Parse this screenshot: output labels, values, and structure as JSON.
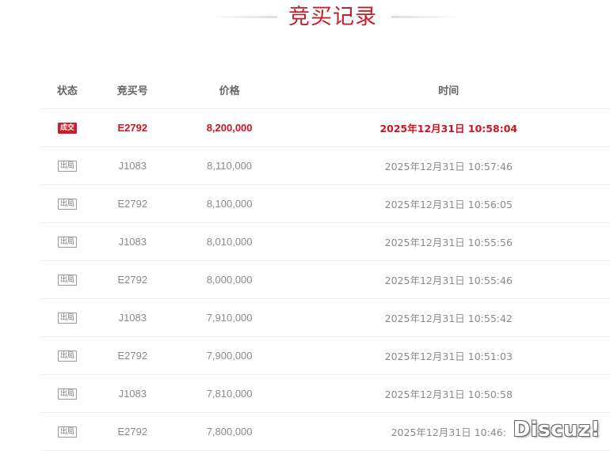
{
  "page_title": "竞买记录",
  "table": {
    "headers": {
      "status": "状态",
      "bid_number": "竞买号",
      "price": "价格",
      "time": "时间"
    },
    "rows": [
      {
        "status": "成交",
        "bid_number": "E2792",
        "price": "8,200,000",
        "time": "2025年12月31日 10:58:04",
        "winner": true
      },
      {
        "status": "出局",
        "bid_number": "J1083",
        "price": "8,110,000",
        "time": "2025年12月31日 10:57:46",
        "winner": false
      },
      {
        "status": "出局",
        "bid_number": "E2792",
        "price": "8,100,000",
        "time": "2025年12月31日 10:56:05",
        "winner": false
      },
      {
        "status": "出局",
        "bid_number": "J1083",
        "price": "8,010,000",
        "time": "2025年12月31日 10:55:56",
        "winner": false
      },
      {
        "status": "出局",
        "bid_number": "E2792",
        "price": "8,000,000",
        "time": "2025年12月31日 10:55:46",
        "winner": false
      },
      {
        "status": "出局",
        "bid_number": "J1083",
        "price": "7,910,000",
        "time": "2025年12月31日 10:55:42",
        "winner": false
      },
      {
        "status": "出局",
        "bid_number": "E2792",
        "price": "7,900,000",
        "time": "2025年12月31日 10:51:03",
        "winner": false
      },
      {
        "status": "出局",
        "bid_number": "J1083",
        "price": "7,810,000",
        "time": "2025年12月31日 10:50:58",
        "winner": false
      },
      {
        "status": "出局",
        "bid_number": "E2792",
        "price": "7,800,000",
        "time": "2025年12月31日 10:46:",
        "winner": false
      }
    ]
  },
  "watermark": "Discuz!",
  "colors": {
    "accent": "#c4202c",
    "winner_badge": "#d3182b",
    "text_muted": "#8a8a8a",
    "divider": "#ececec"
  }
}
